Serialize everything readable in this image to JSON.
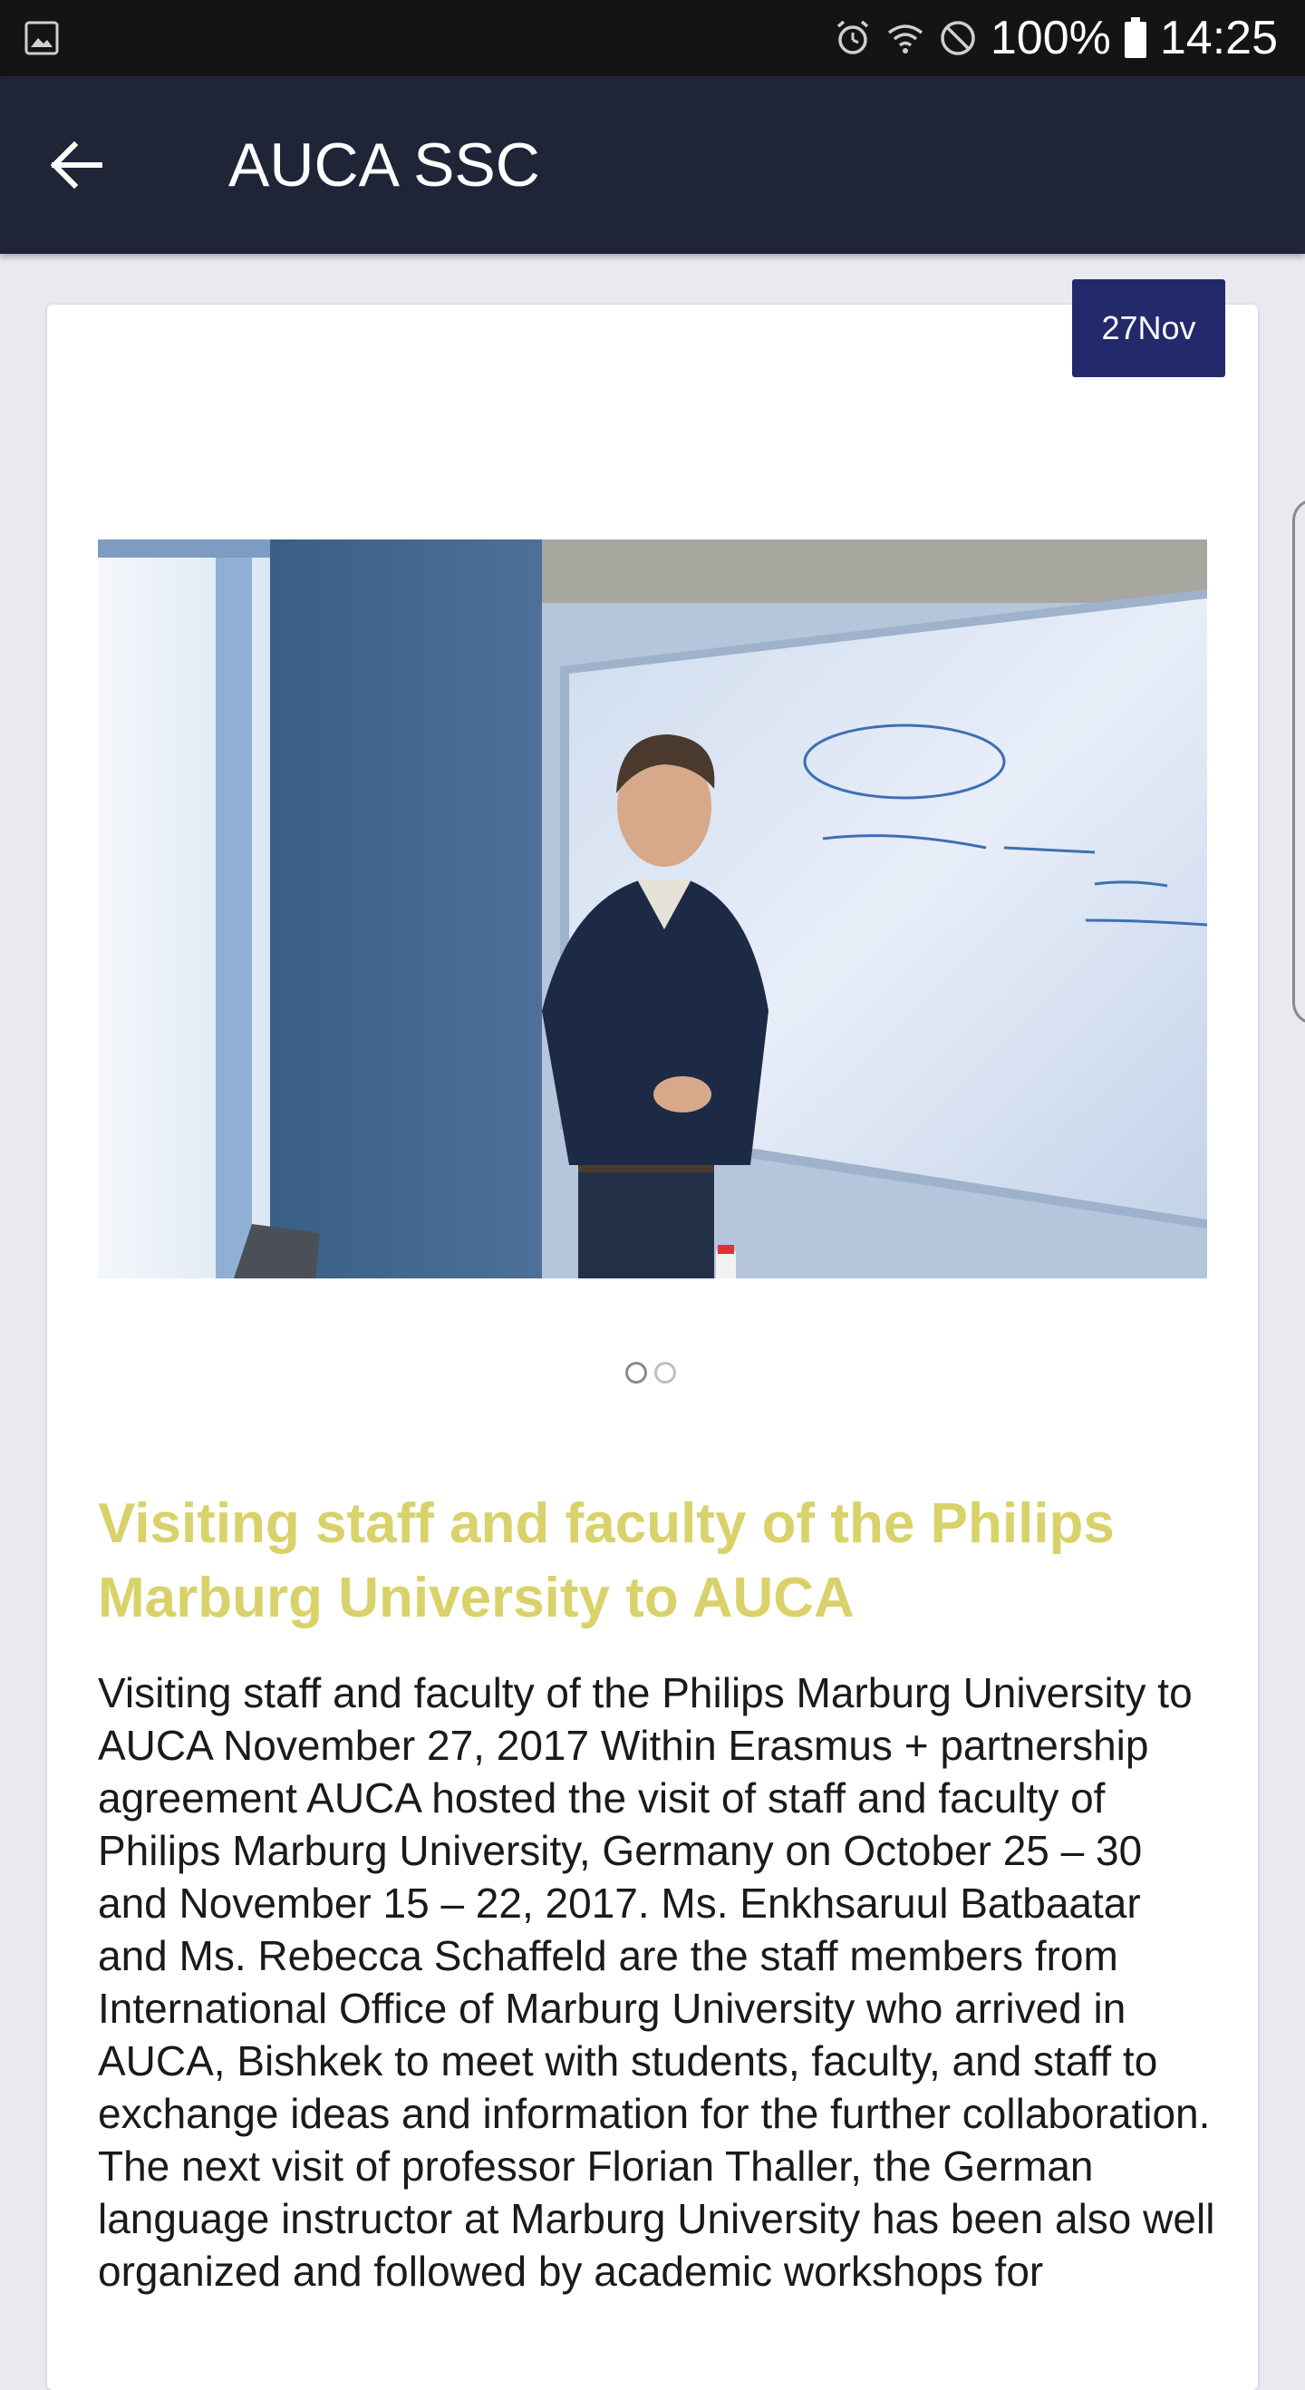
{
  "status_bar": {
    "battery_level": "100%",
    "time": "14:25",
    "icons": [
      "image-notification-icon",
      "alarm-icon",
      "wifi-icon",
      "do-not-disturb-icon",
      "battery-icon"
    ]
  },
  "app_bar": {
    "title": "AUCA SSC",
    "back_icon": "arrow-left-icon"
  },
  "article": {
    "date_badge": "27Nov",
    "carousel": {
      "count": 2,
      "active_index": 0
    },
    "headline": "Visiting staff and faculty of the Philips Marburg University to AUCA",
    "body": "Visiting staff and faculty of the Philips Marburg University to AUCA November 27, 2017 Within Erasmus + partnership agreement AUCA hosted the visit of staff and faculty of Philips Marburg University, Germany on October 25 – 30 and November 15 – 22, 2017.  Ms. Enkhsaruul Batbaatar and Ms. Rebecca Schaffeld are the staff members from International Office of Marburg University who arrived in AUCA, Bishkek to meet with students, faculty, and staff to exchange ideas and information for the further collaboration.  The next visit of professor Florian Thaller, the German language instructor at Marburg University has been also well organized and followed by academic workshops for"
  },
  "colors": {
    "status_bar": "#141414",
    "app_bar": "#1f2437",
    "badge": "#232a6b",
    "headline": "#d9d26a",
    "page_background": "#e9eaf0"
  }
}
